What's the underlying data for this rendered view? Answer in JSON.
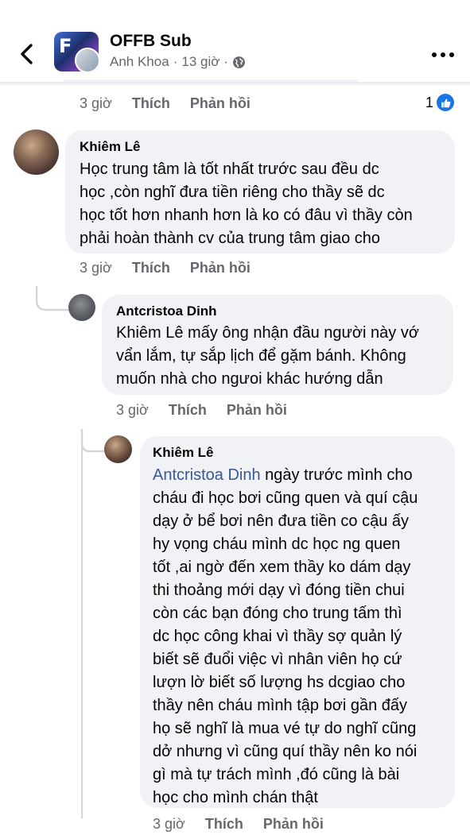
{
  "header": {
    "group_name": "OFFB Sub",
    "author": "Anh Khoa",
    "separator": "·",
    "time": "13 giờ",
    "logo_text": "F"
  },
  "top_actions": {
    "time": "3 giờ",
    "like": "Thích",
    "reply": "Phản hồi",
    "like_count": "1"
  },
  "comments": [
    {
      "author": "Khiêm Lê",
      "text": "Học trung tâm là tốt nhất trước sau đều dc\nhọc ,còn nghĩ đưa tiền riêng cho thầy sẽ dc\nhọc tốt hơn nhanh hơn là ko có đâu vì thầy còn\nphải hoàn thành cv  của trung tâm giao cho",
      "time": "3 giờ",
      "like": "Thích",
      "reply": "Phản hồi"
    },
    {
      "author": "Antcristoa Dinh",
      "text": "Khiêm Lê mấy ông nhận đầu người này vớ\nvẩn lắm, tự sắp lịch để gặm bánh. Không\nmuốn nhà cho ngưoi khác hướng dẫn",
      "time": "3 giờ",
      "like": "Thích",
      "reply": "Phản hồi"
    },
    {
      "author": "Khiêm Lê",
      "mention": "Antcristoa Dinh",
      "text": " ngày trước mình cho\ncháu đi học bơi cũng quen và quí cậu\ndạy ở bể bơi nên đưa tiền co cậu ấy\nhy vọng cháu mình dc học ng quen\ntốt ,ai ngờ đến xem thầy ko dám dạy\nthi thoảng mới dạy vì đóng tiền chui\ncòn các bạn đóng cho trung tấm thì\ndc học công khai vì thầy sợ quản lý\nbiết sẽ đuổi việc vì nhân viên họ cứ\nlượn lờ biết số lượng hs dcgiao cho\nthầy nên cháu mình tập bơi gần đấy\nhọ sẽ nghĩ là mua vé tự do nghĩ cũng\ndở nhưng vì cũng quí thầy nên ko nói\ngì mà tự trách mình ,đó cũng là bài\nhọc cho mình chán thật",
      "time": "3 giờ",
      "like": "Thích",
      "reply": "Phản hồi"
    }
  ],
  "colors": {
    "bubble": "#f0f2f5",
    "secondary_text": "#65676b",
    "mention": "#385898",
    "like_blue": "#1b74e4"
  }
}
